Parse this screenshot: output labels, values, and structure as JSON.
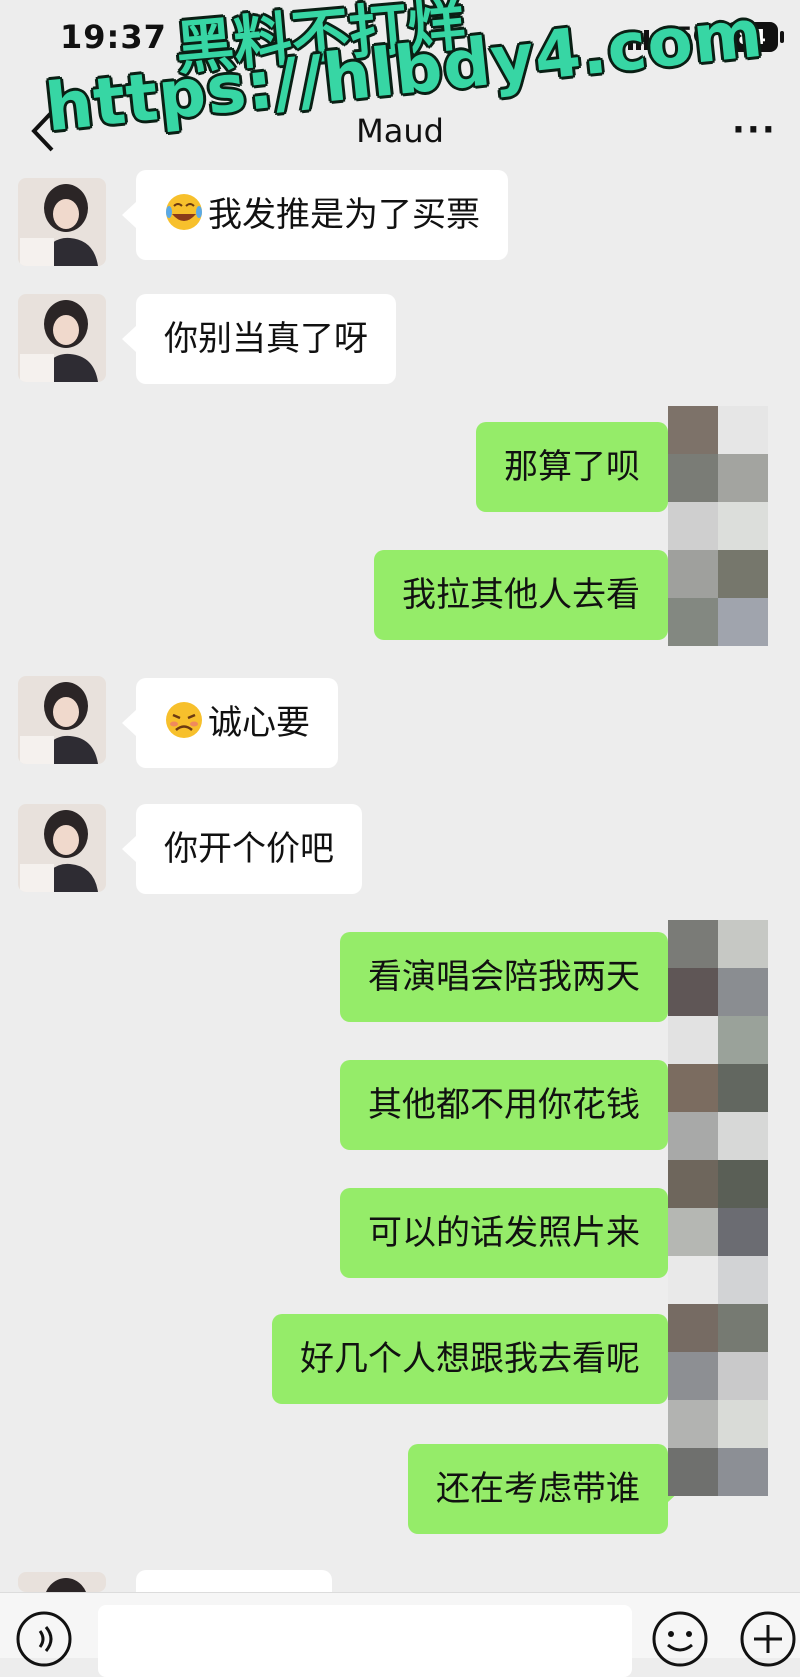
{
  "status_bar": {
    "time": "19:37",
    "network": "5G",
    "battery": "84"
  },
  "nav": {
    "title": "Maud",
    "more_label": "···"
  },
  "watermark": {
    "line1": "黑料不打烊",
    "line2": "https://hlbdy4.com"
  },
  "messages": [
    {
      "side": "in",
      "emoji": "tears-of-joy",
      "text": "我发推是为了买票"
    },
    {
      "side": "in",
      "text": "你别当真了呀"
    },
    {
      "side": "out",
      "text": "那算了呗"
    },
    {
      "side": "out",
      "text": "我拉其他人去看"
    },
    {
      "side": "in",
      "emoji": "persevering-face",
      "text": "诚心要"
    },
    {
      "side": "in",
      "text": "你开个价吧"
    },
    {
      "side": "out",
      "text": "看演唱会陪我两天"
    },
    {
      "side": "out",
      "text": "其他都不用你花钱"
    },
    {
      "side": "out",
      "text": "可以的话发照片来"
    },
    {
      "side": "out",
      "text": "好几个人想跟我去看呢"
    },
    {
      "side": "out",
      "text": "还在考虑带谁"
    }
  ],
  "colors": {
    "background": "#ededed",
    "outgoing_bubble": "#95ec69",
    "incoming_bubble": "#ffffff",
    "watermark": "#37d6a4"
  }
}
